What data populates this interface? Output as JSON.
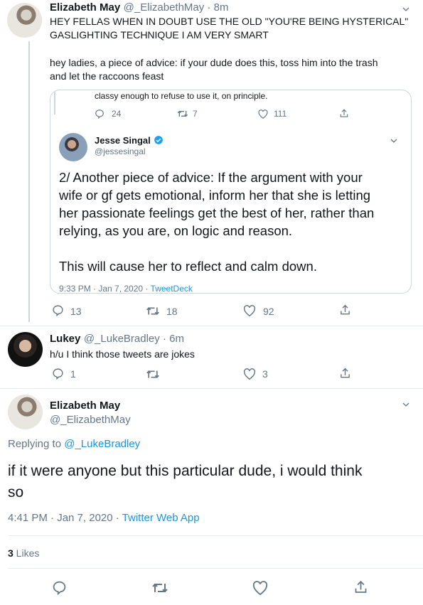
{
  "tweet1": {
    "name": "Elizabeth May",
    "handle_time": "@_ElizabethMay · 8m",
    "line1": "HEY FELLAS WHEN IN DOUBT USE THE OLD \"YOU'RE BEING HYSTERICAL\"",
    "line2": "GASLIGHTING TECHNIQUE I AM VERY SMART",
    "line3": "hey ladies, a piece of advice: if your dude does this, toss him into the trash",
    "line4": "and let the raccoons feast",
    "replies": "13",
    "retweets": "18",
    "likes": "92"
  },
  "quoted": {
    "prev_text": "classy enough to refuse to use it, on principle.",
    "prev_replies": "24",
    "prev_retweets": "7",
    "prev_likes": "111",
    "name": "Jesse Singal",
    "handle": "@jessesingal",
    "body1": "2/ Another piece of advice: If the argument with your",
    "body2": "wife or gf gets emotional, inform her that she is letting",
    "body3": "her passionate feelings get the best of her, rather than",
    "body4": "relying, as you are, on logic and reason.",
    "body5": "This will cause her to reflect and calm down.",
    "timestamp": "9:33 PM · Jan 7, 2020 · ",
    "source": "TweetDeck"
  },
  "tweet2": {
    "name": "Lukey",
    "handle_time": "@_LukeBradley · 6m",
    "text": "h/u I think those tweets are jokes",
    "replies": "1",
    "likes": "3"
  },
  "main": {
    "name": "Elizabeth May",
    "handle": "@_ElizabethMay",
    "replying_label": "Replying to ",
    "replying_to": "@_LukeBradley",
    "text1": "if it were anyone but this particular dude, i would think",
    "text2": "so",
    "timestamp": "4:41 PM · Jan 7, 2020 · ",
    "source": "Twitter Web App",
    "likes_count": "3",
    "likes_label": " Likes"
  },
  "colors": {
    "accent": "#1b95e0",
    "secondary": "#657786",
    "border": "#e6ecf0"
  }
}
